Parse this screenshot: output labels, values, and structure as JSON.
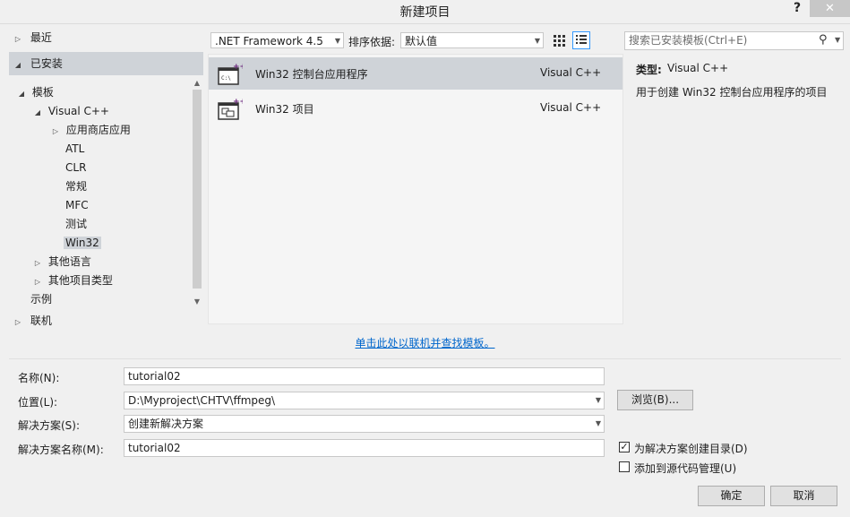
{
  "window": {
    "title": "新建项目",
    "help": "?",
    "close": "✕"
  },
  "nav": {
    "recent": "最近",
    "installed": "已安装",
    "templates": "模板",
    "visual_cpp": "Visual C++",
    "store_apps": "应用商店应用",
    "atl": "ATL",
    "clr": "CLR",
    "general": "常规",
    "mfc": "MFC",
    "test": "测试",
    "win32": "Win32",
    "other_languages": "其他语言",
    "other_project_types": "其他项目类型",
    "samples": "示例",
    "online": "联机"
  },
  "toolbar": {
    "framework": ".NET Framework 4.5",
    "sort_label": "排序依据:",
    "sort_value": "默认值",
    "search_placeholder": "搜索已安装模板(Ctrl+E)"
  },
  "templates": [
    {
      "name": "Win32 控制台应用程序",
      "lang": "Visual C++",
      "icon_text": "C:\\"
    },
    {
      "name": "Win32 项目",
      "lang": "Visual C++"
    }
  ],
  "description": {
    "type_label": "类型:",
    "type_value": "Visual C++",
    "text": "用于创建 Win32 控制台应用程序的项目"
  },
  "online_link": "单击此处以联机并查找模板。",
  "form": {
    "name_label": "名称(N):",
    "name_value": "tutorial02",
    "location_label": "位置(L):",
    "location_value": "D:\\Myproject\\CHTV\\ffmpeg\\",
    "browse": "浏览(B)...",
    "solution_label": "解决方案(S):",
    "solution_value": "创建新解决方案",
    "solution_name_label": "解决方案名称(M):",
    "solution_name_value": "tutorial02",
    "create_dir_label": "为解决方案创建目录(D)",
    "create_dir_checked": true,
    "source_control_label": "添加到源代码管理(U)",
    "source_control_checked": false,
    "ok": "确定",
    "cancel": "取消"
  },
  "colors": {
    "selection": "#cfd3d8",
    "link": "#0066cc",
    "accent": "#3399ff"
  }
}
